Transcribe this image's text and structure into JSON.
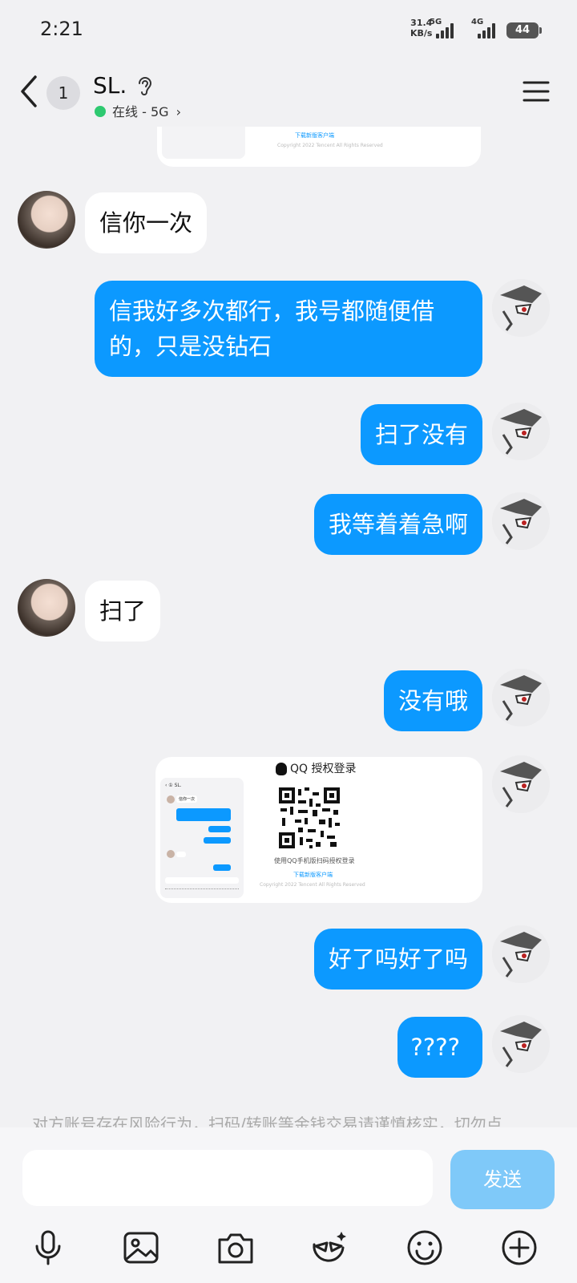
{
  "status_bar": {
    "time": "2:21",
    "net_speed_value": "31.4",
    "net_speed_unit": "KB/s",
    "sim1_label": "5G",
    "sim2_label": "4G",
    "battery": "44"
  },
  "header": {
    "unread_count": "1",
    "contact_name": "SL.",
    "online_status": "在线 - 5G",
    "online_color": "#2ec970"
  },
  "messages": [
    {
      "side": "in",
      "text": "信你一次"
    },
    {
      "side": "out",
      "text_lines": [
        "信我好多次都行，我号都随便借",
        "的，只是没钻石"
      ]
    },
    {
      "side": "out",
      "text": "扫了没有"
    },
    {
      "side": "out",
      "text": "我等着着急啊"
    },
    {
      "side": "in",
      "text": "扫了"
    },
    {
      "side": "out",
      "text": "没有哦"
    },
    {
      "side": "out",
      "type": "image"
    },
    {
      "side": "out",
      "text": "好了吗好了吗"
    },
    {
      "side": "out",
      "text": "????"
    }
  ],
  "image_card": {
    "qq_title": "QQ 授权登录",
    "scan_hint": "使用QQ手机版扫码授权登录",
    "download_link": "下载新版客户端",
    "copyright": "Copyright 2022 Tencent All Rights Reserved",
    "mini_chat_lines": [
      "信你一次",
      "信我好多次都行，我号都随便借的，只是没钻石",
      "扫了没有",
      "我等着着急啊",
      "扫了",
      "没有哦"
    ]
  },
  "warning": "对方账号存在风险行为，扫码/转账等金钱交易请谨慎核实，切勿点",
  "input": {
    "placeholder": "",
    "send_label": "发送"
  },
  "toolbar": [
    "mic-icon",
    "gallery-icon",
    "camera-icon",
    "sticker-icon",
    "emoji-icon",
    "plus-icon"
  ],
  "colors": {
    "outgoing_bubble": "#0c99ff",
    "incoming_bubble": "#ffffff",
    "background": "#f1f1f3",
    "send_button": "#7fc9f9"
  }
}
